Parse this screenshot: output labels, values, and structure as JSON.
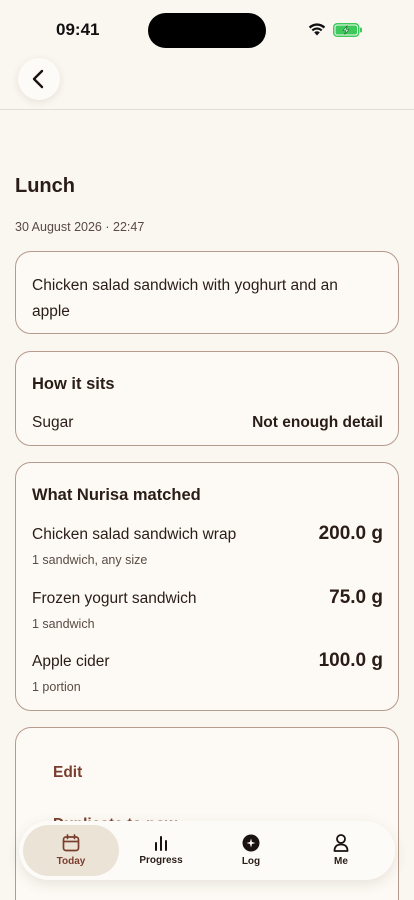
{
  "status_bar": {
    "time": "09:41",
    "battery_color": "#3ec95c"
  },
  "header": {
    "back_icon": "chevron-left-icon"
  },
  "meal": {
    "title": "Lunch",
    "datetime": "30 August 2026 · 22:47",
    "description": "Chicken salad sandwich with yoghurt and an apple"
  },
  "sits": {
    "heading": "How it sits",
    "rows": [
      {
        "label": "Sugar",
        "value": "Not enough detail"
      }
    ]
  },
  "matched": {
    "heading": "What Nurisa matched",
    "items": [
      {
        "name": "Chicken salad sandwich wrap",
        "weight": "200.0 g",
        "portion": "1 sandwich, any size"
      },
      {
        "name": "Frozen yogurt sandwich",
        "weight": "75.0 g",
        "portion": "1 sandwich"
      },
      {
        "name": "Apple cider",
        "weight": "100.0 g",
        "portion": "1 portion"
      }
    ]
  },
  "actions": {
    "edit": "Edit",
    "duplicate": "Duplicate to now"
  },
  "tabs": [
    {
      "label": "Today",
      "icon": "calendar-icon",
      "active": true
    },
    {
      "label": "Progress",
      "icon": "bar-chart-icon",
      "active": false
    },
    {
      "label": "Log",
      "icon": "plus-circle-icon",
      "active": false
    },
    {
      "label": "Me",
      "icon": "person-icon",
      "active": false
    }
  ],
  "colors": {
    "accent": "#7a3e2e",
    "background": "#faf6f0",
    "card_border": "#b59a8e"
  }
}
